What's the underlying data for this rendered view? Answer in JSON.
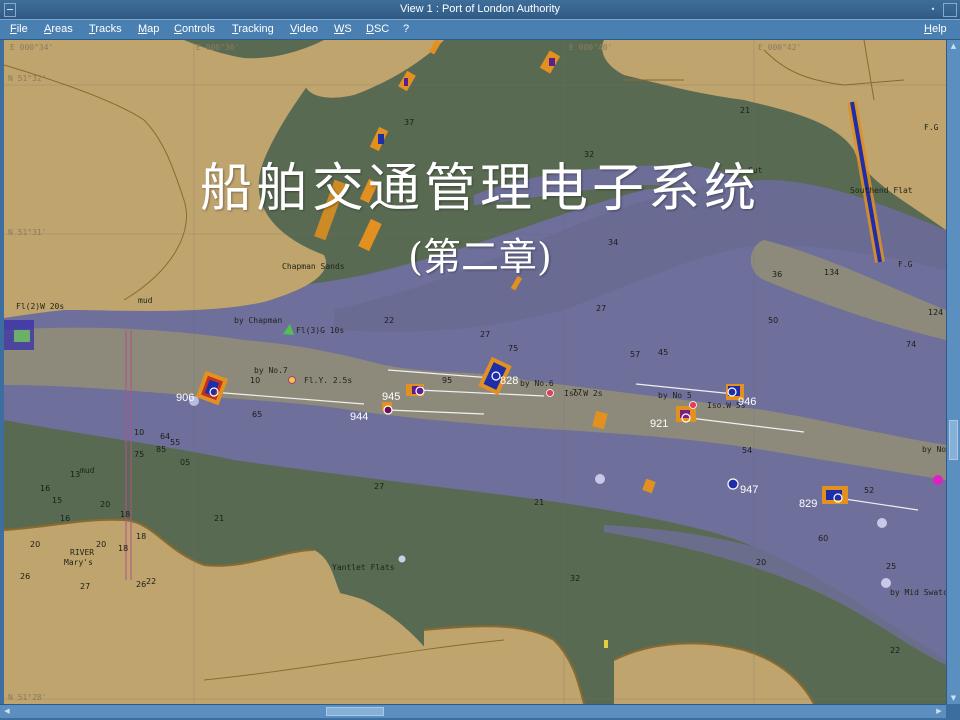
{
  "window": {
    "title": "View 1 : Port of London Authority"
  },
  "menu": {
    "items": [
      "File",
      "Areas",
      "Tracks",
      "Map",
      "Controls",
      "Tracking",
      "Video",
      "WS",
      "DSC",
      "?"
    ],
    "help": "Help"
  },
  "overlay": {
    "title": "船舶交通管理电子系统",
    "subtitle": "(第二章)"
  },
  "coordinates": {
    "lon": [
      "E 000°34'",
      "E 000°36'",
      "E 000°40'",
      "E 000°42'"
    ],
    "lat": [
      "N 51°32'",
      "N 51°31'",
      "N 51°28'"
    ]
  },
  "place_labels": {
    "chapman_sands": "Chapman Sands",
    "by_chapman": "by Chapman",
    "fl3g": "Fl(3)G 10s",
    "fl2w": "Fl(2)W 20s",
    "by_no7": "by No.7",
    "fly": "Fl.Y. 2.5s",
    "by_no6": "by No.6",
    "iso_w_2s": "Iso.W 2s",
    "by_no5": "by No 5",
    "iso_w_5s": "Iso.W 5s",
    "southend_flat": "Southend Flat",
    "fg1": "F.G",
    "fg2": "F.G",
    "yantlet": "Yantlet Flats",
    "by_mid_swatch": "by Mid Swatch",
    "by_no": "by No",
    "mud1": "mud",
    "mud2": "mud",
    "river": "RIVER",
    "marys": "Mary's",
    "cut": "Cut"
  },
  "tracks": [
    {
      "id": "906"
    },
    {
      "id": "944"
    },
    {
      "id": "945"
    },
    {
      "id": "828"
    },
    {
      "id": "921"
    },
    {
      "id": "946"
    },
    {
      "id": "947"
    },
    {
      "id": "829"
    }
  ],
  "depths": [
    "37",
    "32",
    "21",
    "34",
    "36",
    "50",
    "74",
    "124",
    "134",
    "22",
    "27",
    "27",
    "45",
    "57",
    "75",
    "77",
    "95",
    "10",
    "65",
    "54",
    "52",
    "60",
    "25",
    "22",
    "20",
    "27",
    "21",
    "21",
    "32",
    "22",
    "20",
    "18",
    "16",
    "13",
    "15",
    "16",
    "18",
    "20",
    "10",
    "05",
    "85",
    "75",
    "64",
    "55",
    "18",
    "20",
    "26",
    "27",
    "26"
  ],
  "colors": {
    "land": "#c0a46e",
    "intertidal": "#5b6b52",
    "shallow": "#6d6f9a",
    "deep": "#77789f",
    "channel": "#8e8b7a",
    "track_white": "#ffffff"
  }
}
